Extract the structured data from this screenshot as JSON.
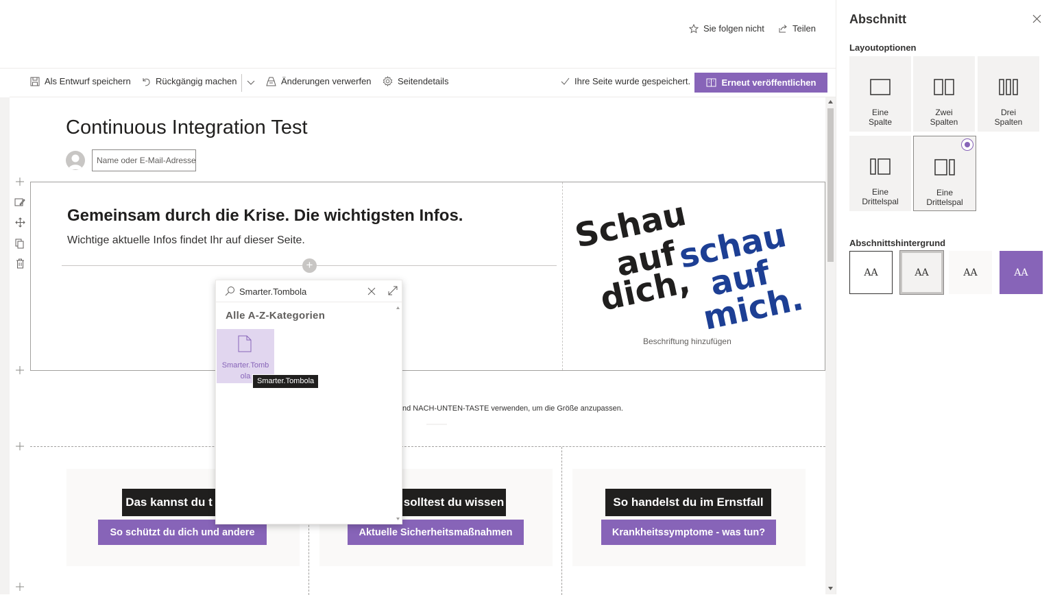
{
  "top": {
    "follow_label": "Sie folgen nicht",
    "share_label": "Teilen"
  },
  "commandbar": {
    "save_draft": "Als Entwurf speichern",
    "undo": "Rückgängig machen",
    "discard": "Änderungen verwerfen",
    "page_details": "Seitendetails",
    "saved_status": "Ihre Seite wurde gespeichert.",
    "republish": "Erneut veröffentlichen"
  },
  "page": {
    "title": "Continuous Integration Test",
    "author_placeholder": "Name oder E-Mail-Adresse"
  },
  "section1": {
    "headline": "Gemeinsam durch die Krise. Die wichtigsten Infos.",
    "subhead": "Wichtige aktuelle Infos findet Ihr auf dieser Seite.",
    "image_lines_black": [
      "Schau",
      "auf",
      "dich,"
    ],
    "image_lines_blue": [
      "schau",
      "auf",
      "mich."
    ],
    "caption": "Beschriftung hinzufügen"
  },
  "resize_hint": "nd NACH-UNTEN-TASTE verwenden, um die Größe anzupassen.",
  "cards": [
    {
      "black": "Das kannst du t",
      "purple": "So schützt du dich und andere"
    },
    {
      "black": "solltest du wissen",
      "purple": "Aktuelle Sicherheitsmaßnahmen"
    },
    {
      "black": "So handelst du im Ernstfall",
      "purple": "Krankheitssymptome - was tun?"
    }
  ],
  "picker": {
    "search_value": "Smarter.Tombola",
    "category_title": "Alle A-Z-Kategorien",
    "item_label_1": "Smarter.Tomb",
    "item_label_2": "ola",
    "tooltip": "Smarter.Tombola"
  },
  "panel": {
    "title": "Abschnitt",
    "layout_label": "Layoutoptionen",
    "layouts": [
      {
        "line1": "Eine",
        "line2": "Spalte"
      },
      {
        "line1": "Zwei",
        "line2": "Spalten"
      },
      {
        "line1": "Drei",
        "line2": "Spalten"
      },
      {
        "line1": "Eine",
        "line2": "Drittelspal"
      },
      {
        "line1": "Eine",
        "line2": "Drittelspal"
      }
    ],
    "background_label": "Abschnittshintergrund",
    "bg_glyph": "AA"
  },
  "colors": {
    "accent": "#8764b8",
    "dark": "#201f1e"
  }
}
